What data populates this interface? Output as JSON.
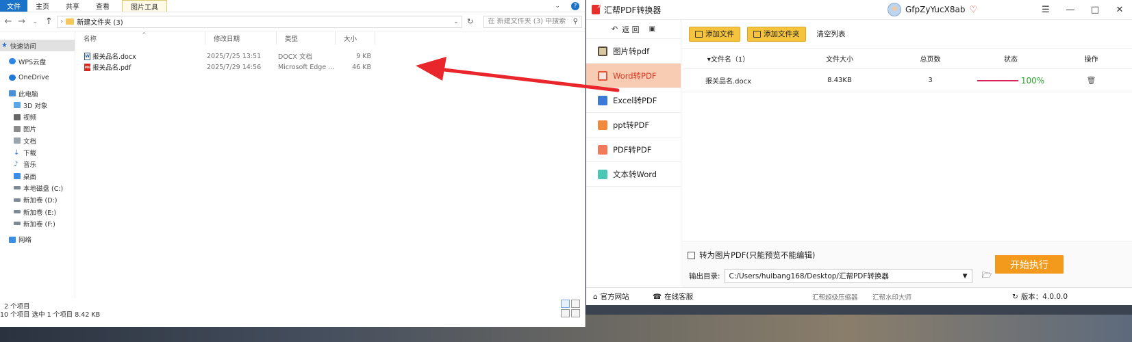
{
  "explorer": {
    "ribbon": {
      "file": "文件",
      "home": "主页",
      "share": "共享",
      "view": "查看",
      "tool": "图片工具"
    },
    "address": {
      "path": "新建文件夹 (3)"
    },
    "search": {
      "placeholder": "在 新建文件夹 (3) 中搜索"
    },
    "nav": {
      "quick_access": "快速访问",
      "wps": "WPS云盘",
      "onedrive": "OneDrive",
      "this_pc": "此电脑",
      "objects3d": "3D 对象",
      "videos": "视频",
      "pictures": "图片",
      "documents": "文档",
      "downloads": "下载",
      "music": "音乐",
      "desktop": "桌面",
      "disk_c": "本地磁盘 (C:)",
      "disk_d": "新加卷 (D:)",
      "disk_e": "新加卷 (E:)",
      "disk_f": "新加卷 (F:)",
      "network": "网络"
    },
    "columns": {
      "name": "名称",
      "date": "修改日期",
      "type": "类型",
      "size": "大小"
    },
    "files": [
      {
        "name": "报关品名.docx",
        "date": "2025/7/25 13:51",
        "type": "DOCX 文档",
        "size": "9 KB",
        "icon": "W"
      },
      {
        "name": "报关品名.pdf",
        "date": "2025/7/29 14:56",
        "type": "Microsoft Edge ...",
        "size": "46 KB",
        "icon": "PDF"
      }
    ],
    "status": {
      "count": "2 个项目",
      "selected": "10 个项目    选中 1 个项目  8.42 KB"
    }
  },
  "app": {
    "title": "汇帮PDF转换器",
    "user": "GfpZyYucX8ab",
    "back": "返 回",
    "sidebar": [
      {
        "label": "图片转pdf",
        "color": "#6b5b95"
      },
      {
        "label": "Word转PDF",
        "color": "#e2553a"
      },
      {
        "label": "Excel转PDF",
        "color": "#3c7ad6"
      },
      {
        "label": "ppt转PDF",
        "color": "#f08a3c"
      },
      {
        "label": "PDF转PDF",
        "color": "#ef7b5a"
      },
      {
        "label": "文本转Word",
        "color": "#4cc7b5"
      }
    ],
    "toolbar": {
      "add_file": "添加文件",
      "add_folder": "添加文件夹",
      "clear": "清空列表"
    },
    "table": {
      "headers": [
        "文件名（1）",
        "文件大小",
        "总页数",
        "状态",
        "操作"
      ],
      "rows": [
        {
          "name": "报关品名.docx",
          "size": "8.43KB",
          "pages": "3",
          "progress": "100%"
        }
      ]
    },
    "options": {
      "to_image_pdf": "转为图片PDF(只能预览不能编辑)",
      "output_label": "输出目录:",
      "output_path": "C:/Users/huibang168/Desktop/汇帮PDF转换器",
      "start": "开始执行"
    },
    "footer": {
      "website": "官方网站",
      "service": "在线客服",
      "compressor": "汇帮超级压缩器",
      "watermark": "汇帮水印大师",
      "version": "版本：4.0.0.0"
    }
  },
  "colors": {
    "accent_orange": "#f39a1c",
    "active_item": "#f7ccb3",
    "arrow": "#e8262b"
  }
}
